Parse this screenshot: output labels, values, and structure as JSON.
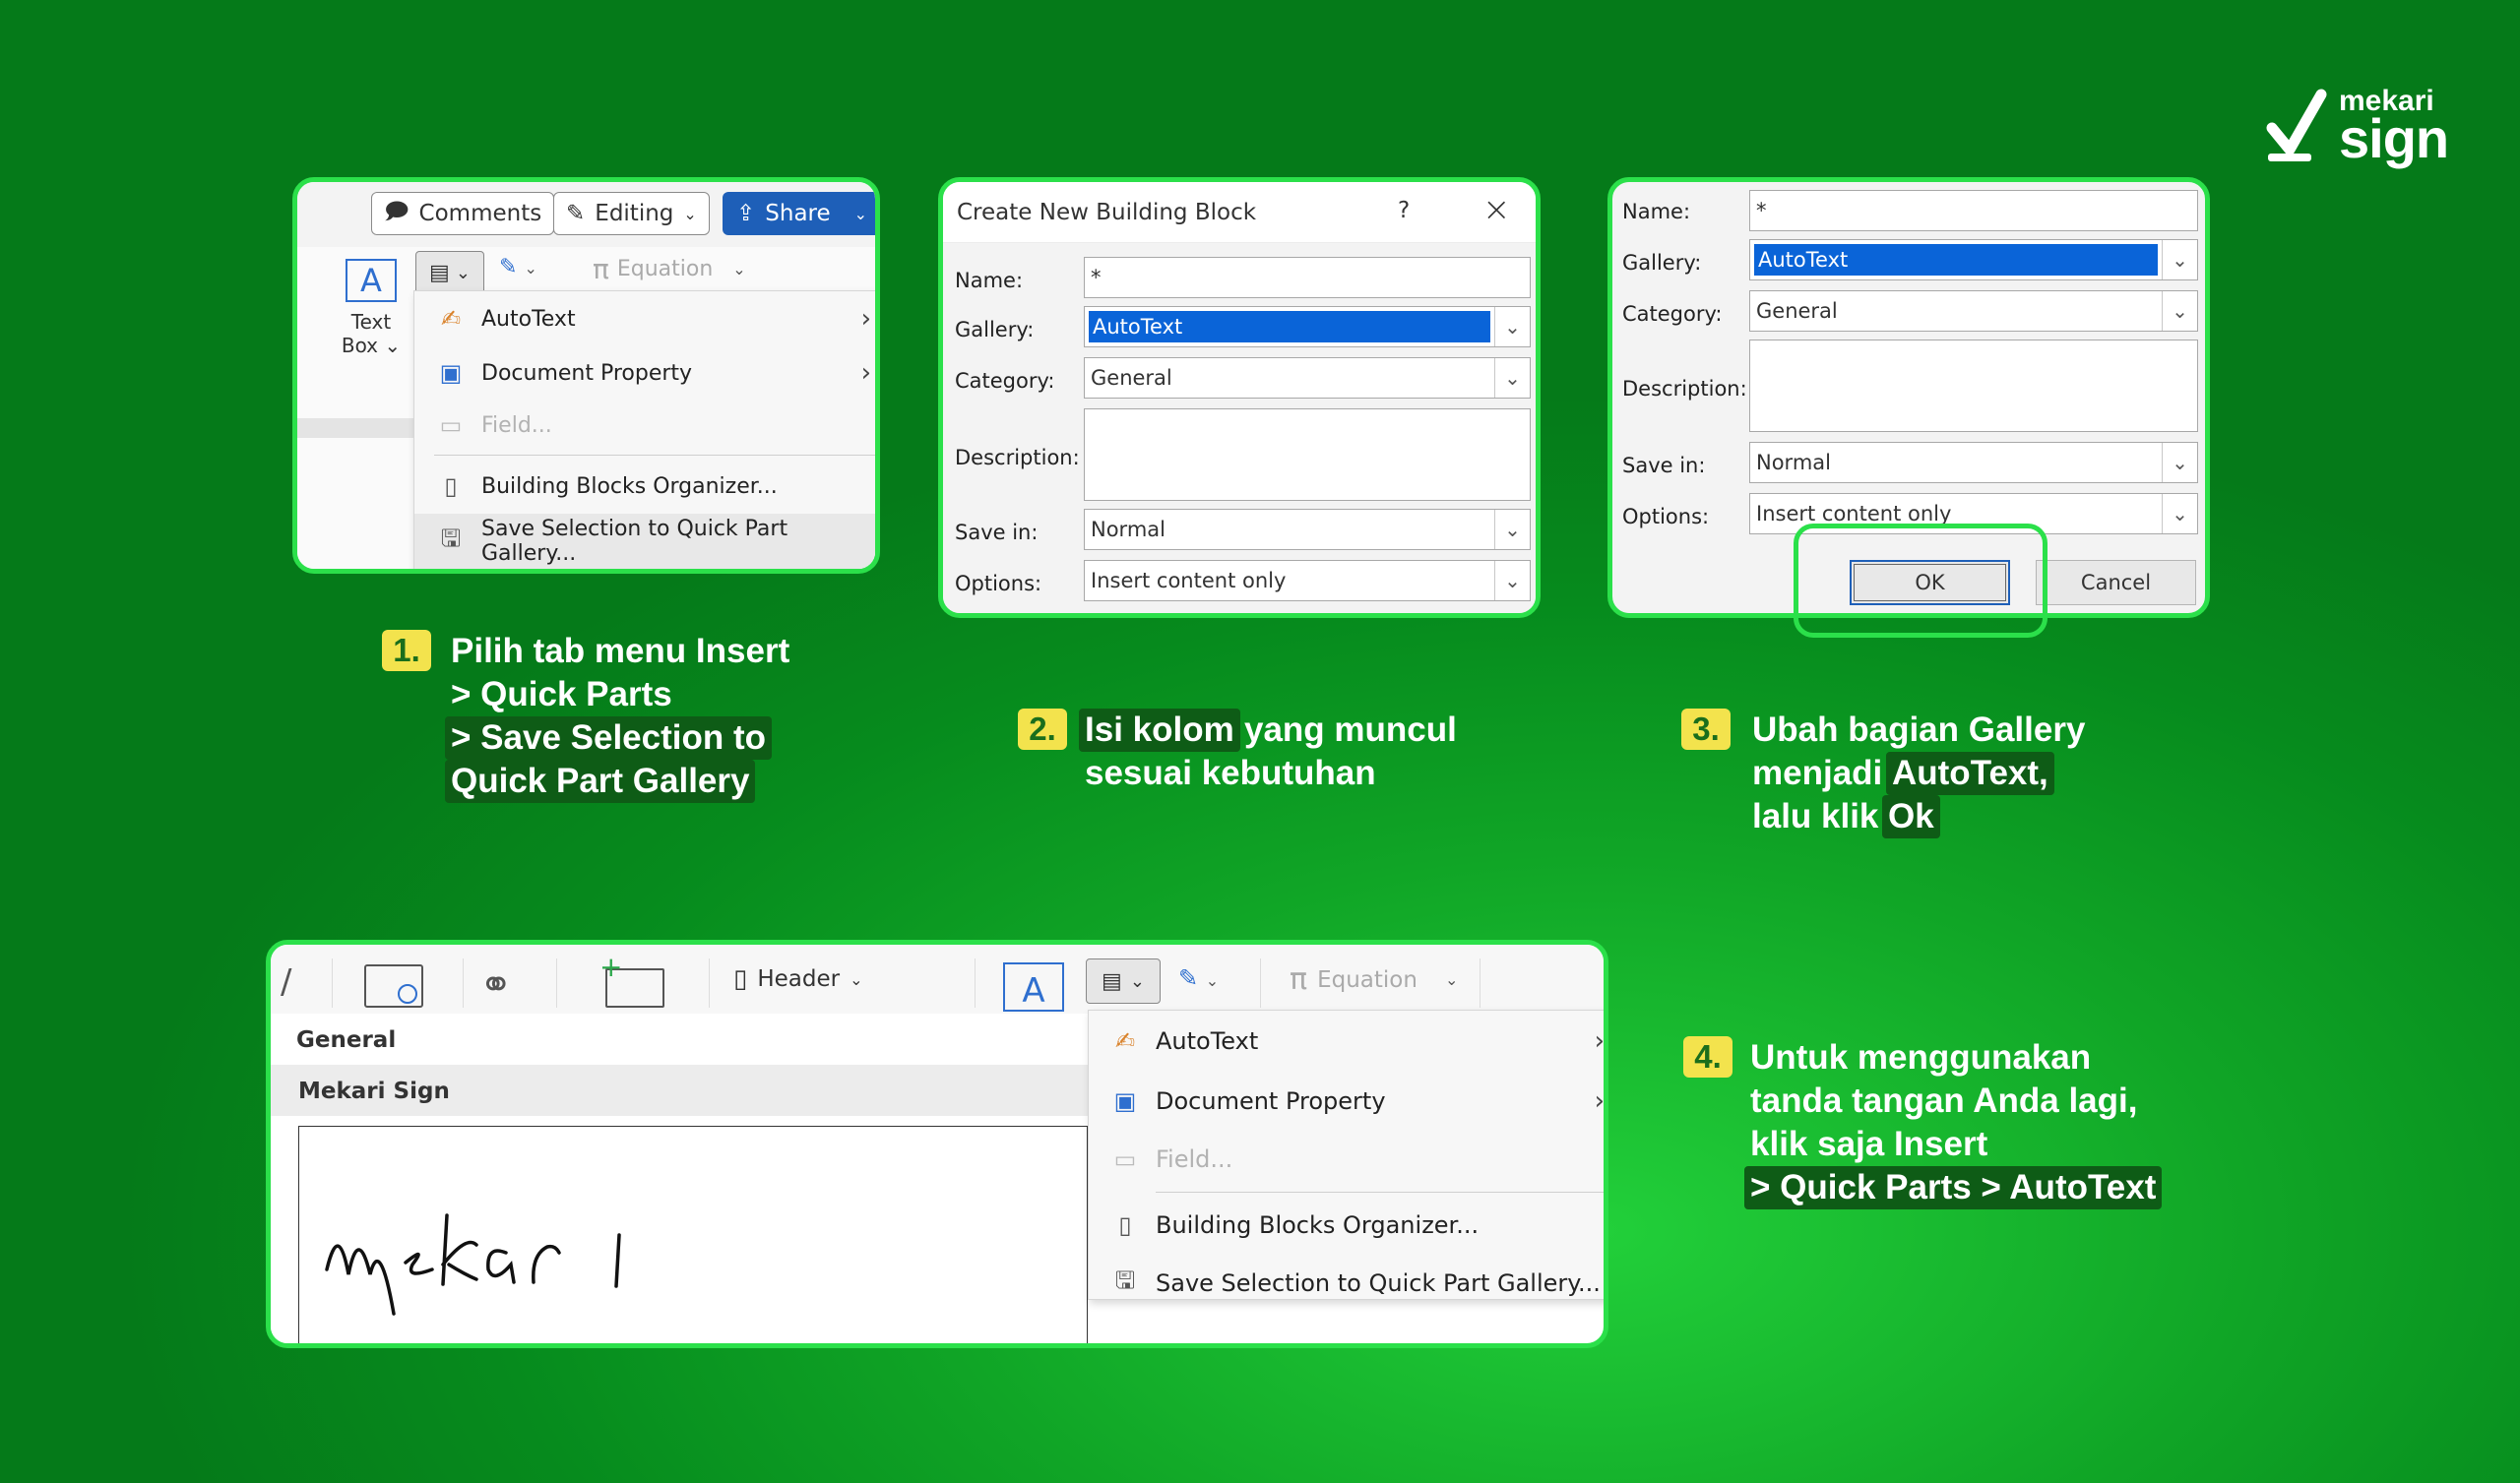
{
  "brand": {
    "line1": "mekari",
    "line2": "sign"
  },
  "panel1": {
    "comments": "Comments",
    "editing": "Editing",
    "share": "Share",
    "equation": "Equation",
    "textbox_line1": "Text",
    "textbox_line2": "Box",
    "menu": [
      "AutoText",
      "Document Property",
      "Field...",
      "Building Blocks Organizer...",
      "Save Selection to Quick Part Gallery..."
    ]
  },
  "panel2": {
    "title": "Create New Building Block",
    "help": "?",
    "name_label": "Name:",
    "name_value": "*",
    "gallery_label": "Gallery:",
    "gallery_value": "AutoText",
    "category_label": "Category:",
    "category_value": "General",
    "description_label": "Description:",
    "savein_label": "Save in:",
    "savein_value": "Normal",
    "options_label": "Options:",
    "options_value": "Insert content only"
  },
  "panel3": {
    "name_label": "Name:",
    "name_value": "*",
    "gallery_label": "Gallery:",
    "gallery_value": "AutoText",
    "category_label": "Category:",
    "category_value": "General",
    "description_label": "Description:",
    "savein_label": "Save in:",
    "savein_value": "Normal",
    "options_label": "Options:",
    "options_value": "Insert content only",
    "ok": "OK",
    "cancel": "Cancel"
  },
  "panel4": {
    "header": "Header",
    "equation": "Equation",
    "gallery_title": "General",
    "entry": "Mekari Sign",
    "menu": [
      "AutoText",
      "Document Property",
      "Field...",
      "Building Blocks Organizer...",
      "Save Selection to Quick Part Gallery..."
    ]
  },
  "steps": [
    {
      "num": "1.",
      "lines": [
        "Pilih tab menu Insert",
        "> Quick Parts",
        "> Save Selection to",
        "Quick Part Gallery"
      ]
    },
    {
      "num": "2.",
      "lines": [
        "Isi kolom",
        "yang muncul",
        "sesuai kebutuhan"
      ]
    },
    {
      "num": "3.",
      "lines": [
        "Ubah bagian Gallery",
        "menjadi",
        "AutoText,",
        "lalu klik",
        "Ok"
      ]
    },
    {
      "num": "4.",
      "lines": [
        "Untuk menggunakan",
        "tanda tangan Anda lagi,",
        "klik saja Insert",
        "> Quick Parts > AutoText"
      ]
    }
  ],
  "colors": {
    "accent_border": "#2be04a",
    "highlight_yellow": "#f3e34d",
    "share_blue": "#1e5fb8",
    "selection_blue": "#0a64d8"
  }
}
